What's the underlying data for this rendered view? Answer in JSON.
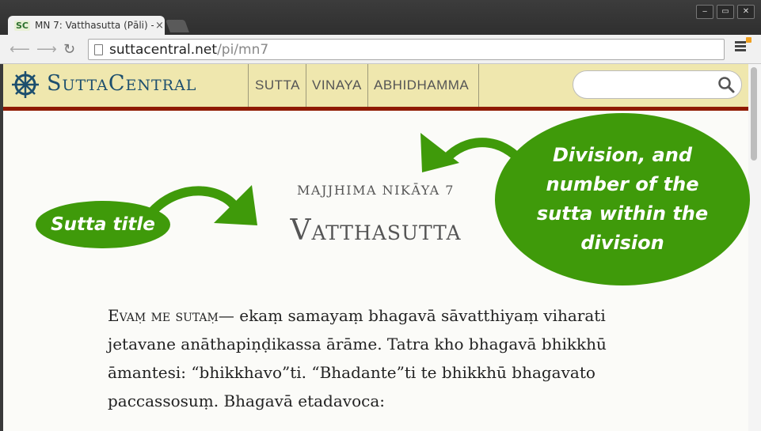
{
  "browser": {
    "tab_favicon": "SC",
    "tab_title": "MN 7: Vatthasutta (Pāli) -",
    "tab_close": "×",
    "url_host": "suttacentral.net",
    "url_path": "/pi/mn7",
    "window_buttons": [
      "‒",
      "▭",
      "✕"
    ]
  },
  "site": {
    "logo": "SuttaCentral",
    "nav": [
      "SUTTA",
      "VINAYA",
      "ABHIDHAMMA"
    ],
    "search_placeholder": "",
    "header_color": "#efe7ae",
    "accent_border": "#8f1a00",
    "logo_color": "#1d4f6e"
  },
  "sutta": {
    "division": "MAJJHIMA NIKĀYA 7",
    "title": "Vatthasutta",
    "opening": "Evaṃ me sutaṃ—",
    "text": " ekaṃ samayaṃ bhagavā sāvatthiyaṃ viharati jetavane anāthapiṇḍikassa ārāme. Tatra kho bhagavā bhikkhū āmantesi: “bhikkhavo”ti. “Bhadante”ti te bhikkhū bhagavato paccassosuṃ. Bhagavā etadavoca:"
  },
  "annotations": {
    "title_note": "Sutta title",
    "division_note": "Division, and number of the sutta within the division",
    "color": "#3f9a0a"
  },
  "icons": [
    "back-icon",
    "forward-icon",
    "reload-icon",
    "page-icon",
    "menu-icon",
    "dharma-wheel-icon",
    "search-icon"
  ]
}
